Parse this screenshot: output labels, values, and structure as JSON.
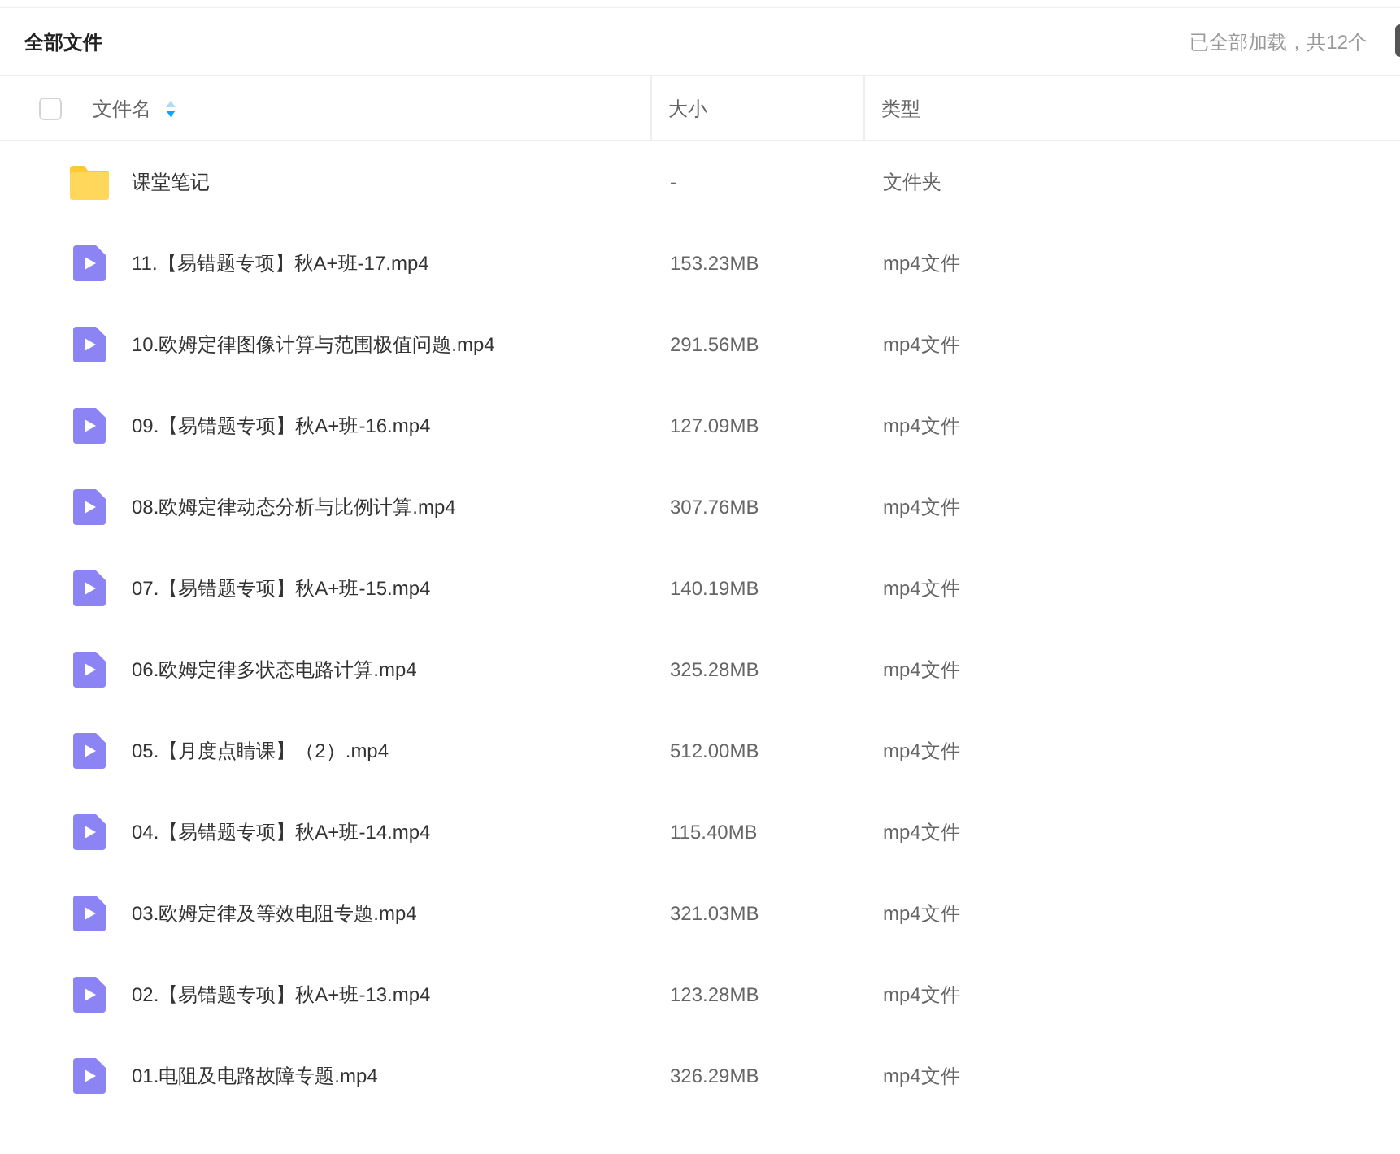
{
  "header": {
    "title": "全部文件",
    "status": "已全部加载，共12个"
  },
  "table": {
    "columns": [
      {
        "label": "文件名",
        "sortable": true
      },
      {
        "label": "大小",
        "sortable": false
      },
      {
        "label": "类型",
        "sortable": false
      }
    ],
    "select_all": {
      "checked": false
    },
    "rows": [
      {
        "kind": "folder",
        "name": "课堂笔记",
        "size": "-",
        "type": "文件夹"
      },
      {
        "kind": "video",
        "name": "11.【易错题专项】秋A+班-17.mp4",
        "size": "153.23MB",
        "type": "mp4文件"
      },
      {
        "kind": "video",
        "name": "10.欧姆定律图像计算与范围极值问题.mp4",
        "size": "291.56MB",
        "type": "mp4文件"
      },
      {
        "kind": "video",
        "name": "09.【易错题专项】秋A+班-16.mp4",
        "size": "127.09MB",
        "type": "mp4文件"
      },
      {
        "kind": "video",
        "name": "08.欧姆定律动态分析与比例计算.mp4",
        "size": "307.76MB",
        "type": "mp4文件"
      },
      {
        "kind": "video",
        "name": "07.【易错题专项】秋A+班-15.mp4",
        "size": "140.19MB",
        "type": "mp4文件"
      },
      {
        "kind": "video",
        "name": "06.欧姆定律多状态电路计算.mp4",
        "size": "325.28MB",
        "type": "mp4文件"
      },
      {
        "kind": "video",
        "name": "05.【月度点睛课】（2）.mp4",
        "size": "512.00MB",
        "type": "mp4文件"
      },
      {
        "kind": "video",
        "name": "04.【易错题专项】秋A+班-14.mp4",
        "size": "115.40MB",
        "type": "mp4文件"
      },
      {
        "kind": "video",
        "name": "03.欧姆定律及等效电阻专题.mp4",
        "size": "321.03MB",
        "type": "mp4文件"
      },
      {
        "kind": "video",
        "name": "02.【易错题专项】秋A+班-13.mp4",
        "size": "123.28MB",
        "type": "mp4文件"
      },
      {
        "kind": "video",
        "name": "01.电阻及电路故障专题.mp4",
        "size": "326.29MB",
        "type": "mp4文件"
      }
    ]
  }
}
